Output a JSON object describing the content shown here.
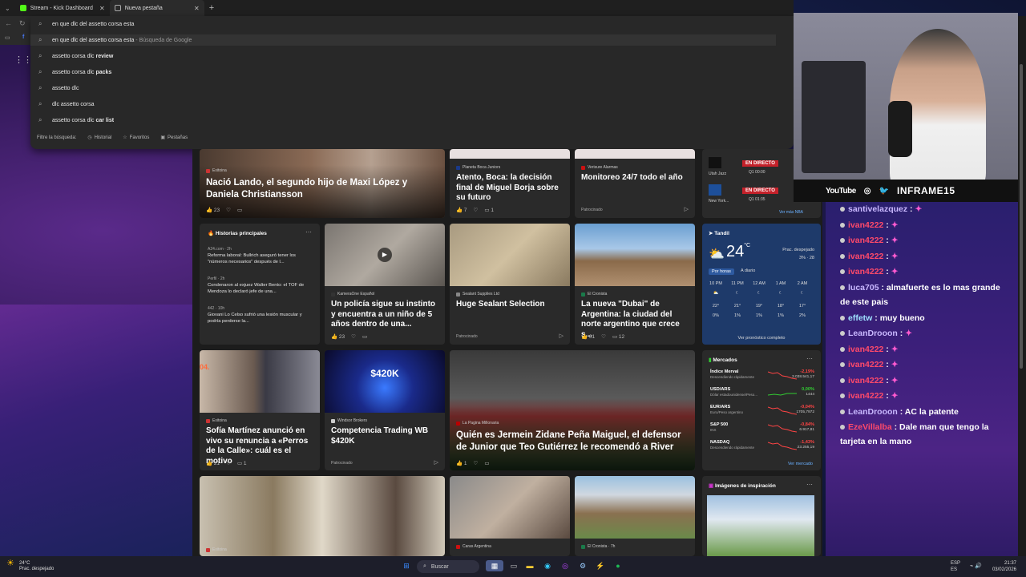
{
  "browser": {
    "tabs": [
      {
        "label": "Stream - Kick Dashboard",
        "color": "#53fc18"
      },
      {
        "label": "Nueva pestaña",
        "color": "#9aa0a6"
      }
    ],
    "query": "en que dlc del assetto corsa esta",
    "suggestions": [
      {
        "text": "en que dlc del assetto corsa esta",
        "suffix": " - Búsqueda de Google",
        "bold": "",
        "icon": "search-icon"
      },
      {
        "text": "assetto corsa dlc ",
        "suffix": "",
        "bold": "review",
        "icon": "search-icon"
      },
      {
        "text": "assetto corsa dlc ",
        "suffix": "",
        "bold": "packs",
        "icon": "search-icon"
      },
      {
        "text": "assetto dlc",
        "suffix": "",
        "bold": "",
        "icon": "search-icon"
      },
      {
        "text": "dlc assetto corsa",
        "suffix": "",
        "bold": "",
        "icon": "search-icon"
      },
      {
        "text": "assetto corsa dlc ",
        "suffix": "",
        "bold": "car list",
        "icon": "search-icon"
      }
    ],
    "filter": {
      "label": "Filtre la búsqueda:",
      "historial": "Historial",
      "favoritos": "Favoritos",
      "pestanas": "Pestañas"
    }
  },
  "feed": {
    "top_card": {
      "source": "Exitoina",
      "title": "Nació Lando, el segundo hijo de Maxi López y Daniela Christiansson",
      "likes": "23"
    },
    "boca": {
      "source": "Planeta Boca Juniors",
      "title": "Atento, Boca: la decisión final de Miguel Borja sobre su futuro",
      "likes": "7",
      "comments": "1"
    },
    "alarm": {
      "source": "Verisure Alarmas",
      "title": "Monitoreo 24/7 todo el año",
      "sponsored": "Patrocinado"
    },
    "nba": {
      "team1": "Utah Jazz",
      "team2": "New York...",
      "live": "EN DIRECTO",
      "q1": "Q1 00:00",
      "q2": "Q1 01:35",
      "more": "Ver más NBA"
    },
    "historias": {
      "title": "Historias principales",
      "items": [
        {
          "src": "A24.com · 2h",
          "text": "Reforma laboral: Bullrich aseguró tener los \"números necesarios\" después de l..."
        },
        {
          "src": "Perfil · 2h",
          "text": "Condenaron al exjuez Walter Bento: el TOF de Mendoza lo declaró jefe de una..."
        },
        {
          "src": "442 · 10h",
          "text": "Giovani Lo Celso sufrió una lesión muscular y podría perderse la..."
        }
      ]
    },
    "policia": {
      "source": "KameraOne Español",
      "title": "Un policía sigue su instinto y encuentra a un niño de 5 años dentro de una...",
      "likes": "23"
    },
    "sealant": {
      "source": "Sealant Supplies Ltd",
      "title": "Huge Sealant Selection",
      "sponsored": "Patrocinado"
    },
    "dubai": {
      "source": "El Cronista",
      "title": "La nueva \"Dubai\" de Argentina: la ciudad del norte argentino que crece s...",
      "likes": "61",
      "comments": "12"
    },
    "weather": {
      "city": "Tandil",
      "temp": "24",
      "unit": "°C",
      "desc": "Prac. despejado",
      "rain": "3%",
      "wind": "28",
      "tab1": "Por horas",
      "tab2": "A diario",
      "hours": [
        "10 PM",
        "11 PM",
        "12 AM",
        "1 AM",
        "2 AM"
      ],
      "temps": [
        "22°",
        "21°",
        "19°",
        "18°",
        "17°"
      ],
      "precip": [
        "0%",
        "1%",
        "1%",
        "1%",
        "2%"
      ],
      "more": "Ver pronóstico completo"
    },
    "sofia": {
      "source": "Exitoina",
      "title": "Sofía Martínez anunció en vivo su renuncia a «Perros de la Calle»: cuál es el motivo",
      "likes": "21",
      "comments": "1",
      "tag": "04."
    },
    "trading": {
      "source": "Windsor Brokers",
      "title": "Competencia Trading WB $420K",
      "sponsored": "Patrocinado",
      "badge": "$420K"
    },
    "zidane": {
      "source": "La Pagina Millonaria",
      "title": "Quién es Jermein Zidane Peña Maiguel, el defensor de Junior que Teo Gutiérrez le recomendó a River",
      "likes": "1"
    },
    "mercados": {
      "title": "Mercados",
      "rows": [
        {
          "name": "Índice Merval",
          "sub": "Descendiendo rápidamente",
          "chg": "-2,19%",
          "val": "3.038.541,17",
          "up": false
        },
        {
          "name": "USD/ARS",
          "sub": "Dólar estadounidense/Peso...",
          "chg": "0,00%",
          "val": "1444",
          "up": true
        },
        {
          "name": "EUR/ARS",
          "sub": "Euro/Peso argentino",
          "chg": "-0,04%",
          "val": "1705,7972",
          "up": false
        },
        {
          "name": "S&P 500",
          "sub": "INX",
          "chg": "-0,84%",
          "val": "6.917,81",
          "up": false
        },
        {
          "name": "NASDAQ",
          "sub": "Descendiendo rápidamente",
          "chg": "-1,43%",
          "val": "23.255,19",
          "up": false
        }
      ],
      "more": "Ver mercado"
    },
    "bottom": {
      "b1_source": "Exitoina",
      "b2_source": "Caras Argentina",
      "b3_source": "El Cronista · 7h",
      "inspiracion": "Imágenes de inspiración"
    }
  },
  "stream": {
    "yt": "YouTube",
    "handle": "INFRAME15",
    "chat": [
      {
        "user": "santivelazquez",
        "text": "",
        "emote": true,
        "color": "normal"
      },
      {
        "user": "ivan4222",
        "text": "",
        "emote": true,
        "color": "red"
      },
      {
        "user": "ivan4222",
        "text": "",
        "emote": true,
        "color": "red"
      },
      {
        "user": "ivan4222",
        "text": "",
        "emote": true,
        "color": "red"
      },
      {
        "user": "ivan4222",
        "text": "",
        "emote": true,
        "color": "red"
      },
      {
        "user": "luca705",
        "text": "almafuerte es lo mas grande de este pais",
        "emote": false,
        "color": "normal"
      },
      {
        "user": "effetw",
        "text": "muy bueno",
        "emote": false,
        "color": "cyan"
      },
      {
        "user": "LeanDrooon",
        "text": "",
        "emote": true,
        "color": "normal"
      },
      {
        "user": "ivan4222",
        "text": "",
        "emote": true,
        "color": "red"
      },
      {
        "user": "ivan4222",
        "text": "",
        "emote": true,
        "color": "red"
      },
      {
        "user": "ivan4222",
        "text": "",
        "emote": true,
        "color": "red"
      },
      {
        "user": "ivan4222",
        "text": "",
        "emote": true,
        "color": "red"
      },
      {
        "user": "LeanDrooon",
        "text": "AC la patente",
        "emote": false,
        "color": "normal"
      },
      {
        "user": "EzeVillalba",
        "text": "Dale man que tengo la tarjeta en la mano",
        "emote": false,
        "color": "red"
      }
    ]
  },
  "taskbar": {
    "weather_temp": "24°C",
    "weather_desc": "Prac. despejado",
    "search": "Buscar",
    "lang1": "ESP",
    "lang2": "ES",
    "time": "21:37",
    "date": "03/02/2026"
  }
}
